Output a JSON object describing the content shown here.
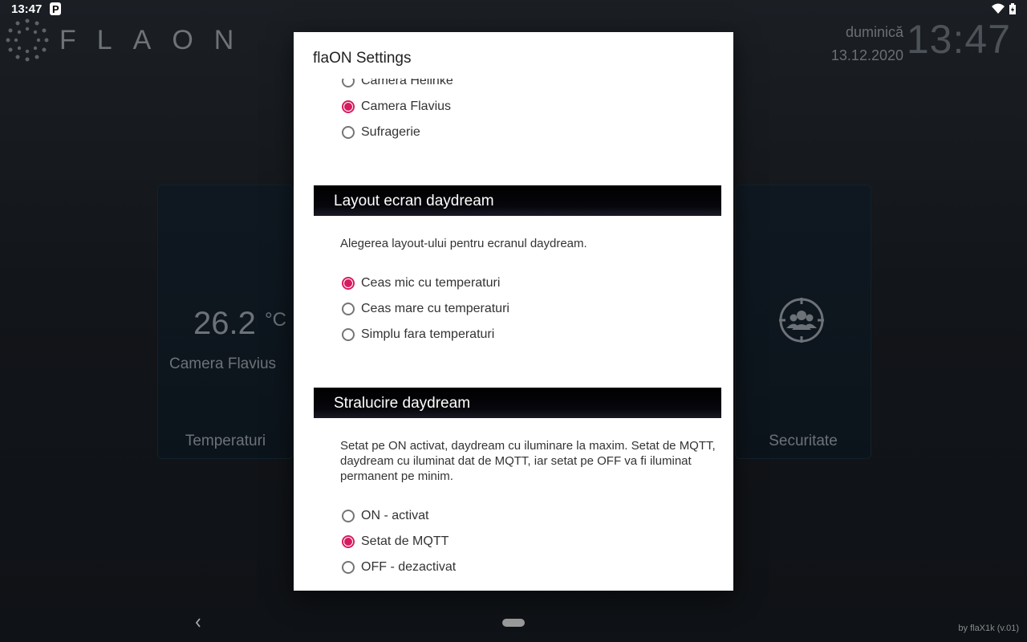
{
  "status_bar": {
    "time": "13:47"
  },
  "app": {
    "logo_text": "FLAON",
    "day": "duminică",
    "date": "13.12.2020",
    "clock": "13:47",
    "temp_card": {
      "value": "26.2",
      "unit": "°C",
      "room": "Camera Flavius",
      "label": "Temperaturi"
    },
    "security_card": {
      "label": "Securitate"
    },
    "credit": "by flaX1k (v.01)"
  },
  "dialog": {
    "title": "flaON Settings",
    "room_options": [
      {
        "label": "Camera Helinke",
        "checked": false
      },
      {
        "label": "Camera Flavius",
        "checked": true
      },
      {
        "label": "Sufragerie",
        "checked": false
      }
    ],
    "layout_section": {
      "header": "Layout ecran daydream",
      "description": "Alegerea layout-ului pentru ecranul daydream.",
      "options": [
        {
          "label": "Ceas mic cu temperaturi",
          "checked": true
        },
        {
          "label": "Ceas mare cu temperaturi",
          "checked": false
        },
        {
          "label": "Simplu fara temperaturi",
          "checked": false
        }
      ]
    },
    "brightness_section": {
      "header": "Stralucire daydream",
      "description": "Setat pe ON activat, daydream cu iluminare la maxim. Setat de MQTT, daydream cu iluminat dat de MQTT, iar setat pe OFF va fi iluminat permanent pe minim.",
      "options": [
        {
          "label": "ON - activat",
          "checked": false
        },
        {
          "label": "Setat de MQTT",
          "checked": true
        },
        {
          "label": "OFF - dezactivat",
          "checked": false
        }
      ]
    }
  },
  "colors": {
    "accent": "#d81b60"
  }
}
